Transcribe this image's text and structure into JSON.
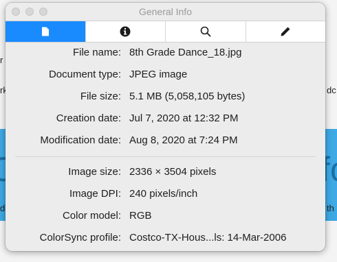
{
  "window": {
    "title": "General Info"
  },
  "tabs": [
    {
      "name": "tab-general",
      "icon": "document-icon",
      "active": true
    },
    {
      "name": "tab-more-info",
      "icon": "info-circle-icon",
      "active": false
    },
    {
      "name": "tab-search",
      "icon": "search-icon",
      "active": false
    },
    {
      "name": "tab-edit",
      "icon": "pencil-icon",
      "active": false
    }
  ],
  "info": {
    "file_name": {
      "label": "File name:",
      "value": "8th Grade Dance_18.jpg"
    },
    "document_type": {
      "label": "Document type:",
      "value": "JPEG image"
    },
    "file_size": {
      "label": "File size:",
      "value": "5.1 MB (5,058,105 bytes)"
    },
    "creation_date": {
      "label": "Creation date:",
      "value": "Jul 7, 2020 at 12:32 PM"
    },
    "modification_date": {
      "label": "Modification date:",
      "value": "Aug 8, 2020 at 7:24 PM"
    },
    "image_size": {
      "label": "Image size:",
      "value": "2336 × 3504 pixels"
    },
    "image_dpi": {
      "label": "Image DPI:",
      "value": "240 pixels/inch"
    },
    "color_model": {
      "label": "Color model:",
      "value": "RGB"
    },
    "colorsync_profile": {
      "label": "ColorSync profile:",
      "value": "Costco-TX-Hous...ls: 14-Mar-2006"
    }
  },
  "background": {
    "fragments": [
      "r",
      "rk",
      "dc",
      "d",
      "th",
      "C",
      "fc"
    ]
  },
  "colors": {
    "accent": "#1a8aff",
    "background_band": "#3ea9e4"
  }
}
